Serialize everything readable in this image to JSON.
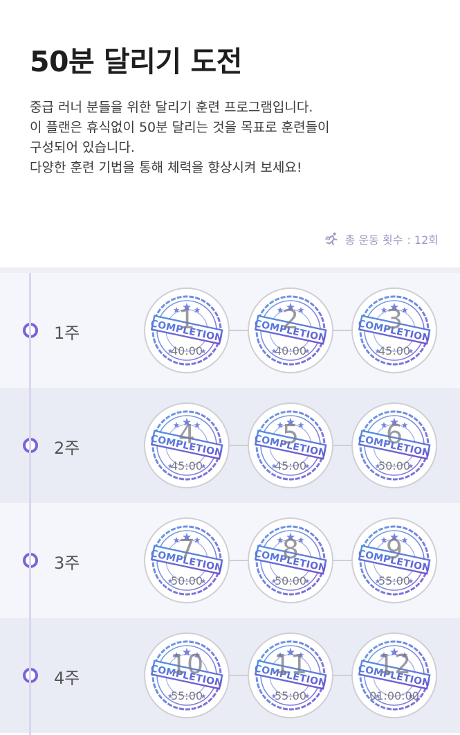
{
  "page": {
    "title": "50분 달리기 도전",
    "description": [
      "중급 러너 분들을 위한 달리기 훈련 프로그램입니다.",
      "이 플랜은 휴식없이 50분 달리는 것을 목표로 훈련들이",
      "구성되어 있습니다.",
      "다양한 훈련 기법을 통해 체력을 향상시켜 보세요!"
    ],
    "total": {
      "icon": "running-person-icon",
      "label": "총 운동 횟수",
      "value": ": 12회"
    }
  },
  "stamp": {
    "text": "COMPLETION",
    "color": "#5a62d8"
  },
  "weeks": [
    {
      "label": "1주",
      "sessions": [
        {
          "number": "1",
          "time": "40:00"
        },
        {
          "number": "2",
          "time": "40:00"
        },
        {
          "number": "3",
          "time": "45:00"
        }
      ]
    },
    {
      "label": "2주",
      "sessions": [
        {
          "number": "4",
          "time": "45:00"
        },
        {
          "number": "5",
          "time": "45:00"
        },
        {
          "number": "6",
          "time": "50:00"
        }
      ]
    },
    {
      "label": "3주",
      "sessions": [
        {
          "number": "7",
          "time": "50:00"
        },
        {
          "number": "8",
          "time": "50:00"
        },
        {
          "number": "9",
          "time": "55:00"
        }
      ]
    },
    {
      "label": "4주",
      "sessions": [
        {
          "number": "10",
          "time": "55:00"
        },
        {
          "number": "11",
          "time": "55:00"
        },
        {
          "number": "12",
          "time": "01:00:00"
        }
      ]
    }
  ]
}
